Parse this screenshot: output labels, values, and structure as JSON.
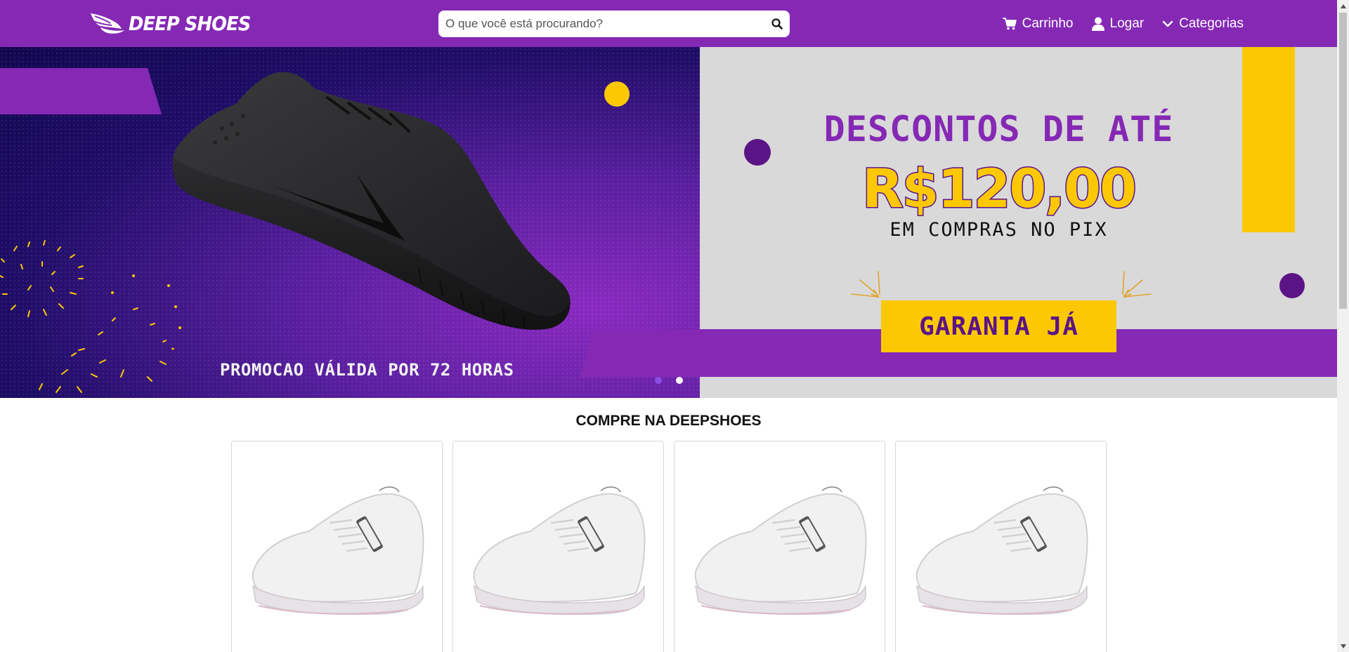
{
  "header": {
    "brand": "DEEP SHOES",
    "search_placeholder": "O que você está procurando?",
    "nav": {
      "cart": "Carrinho",
      "login": "Logar",
      "categories": "Categorias"
    },
    "colors": {
      "primary": "#8529b5",
      "accent": "#fcc804"
    }
  },
  "banner": {
    "headline": "DESCONTOS DE ATÉ",
    "price": "R$120,00",
    "subline": "EM COMPRAS NO PIX",
    "cta": "GARANTA JÁ",
    "validity": "PROMOCAO VÁLIDA POR 72 HORAS",
    "slides_total": 2,
    "active_slide": 1
  },
  "products": {
    "title": "COMPRE NA DEEPSHOES",
    "items": [
      {
        "image": "white-sneaker"
      },
      {
        "image": "white-sneaker"
      },
      {
        "image": "white-sneaker"
      },
      {
        "image": "white-sneaker"
      }
    ]
  },
  "icons": {
    "logo": "wing-logo-icon",
    "search": "search-icon",
    "cart": "cart-icon",
    "user": "user-icon",
    "chevron": "chevron-down-icon"
  }
}
